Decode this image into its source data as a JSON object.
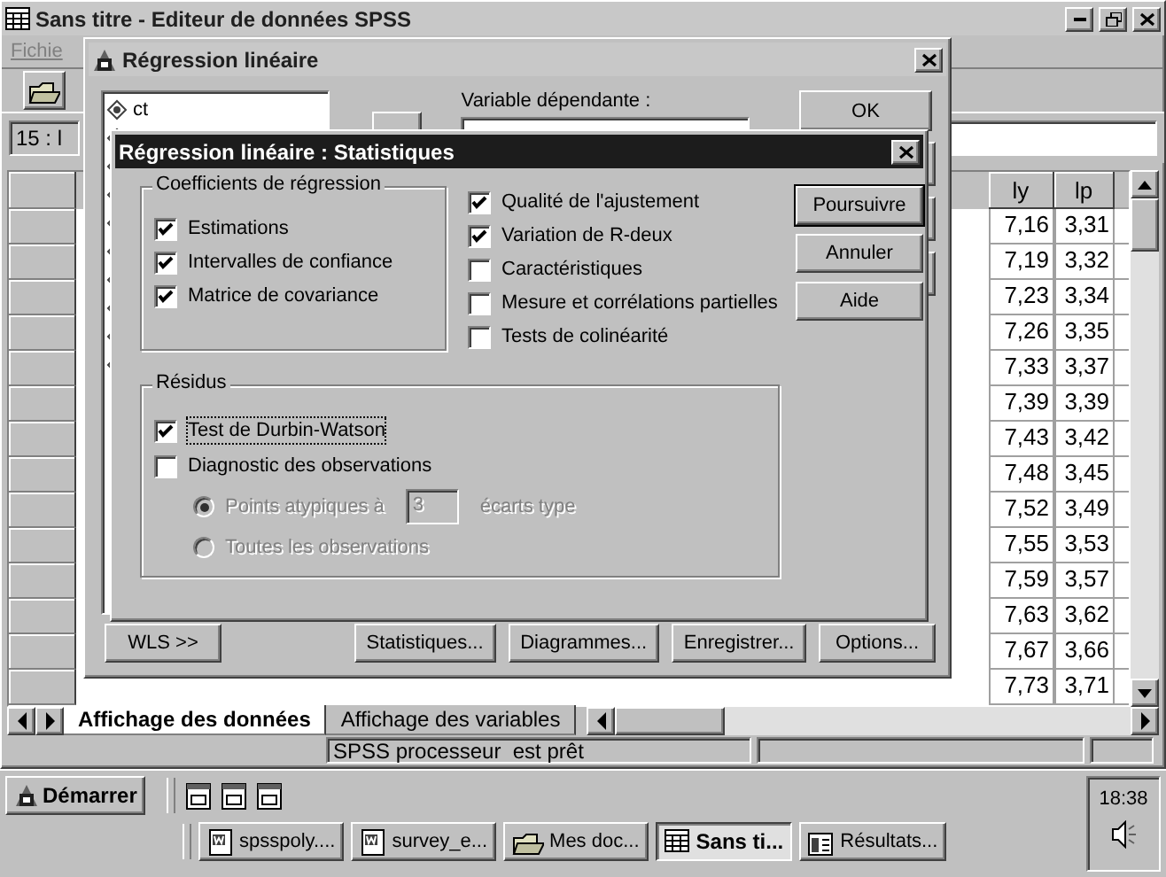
{
  "main_window": {
    "title": "Sans titre - Editeur de données SPSS",
    "menu": [
      "Fichie"
    ],
    "cell_ref": "15 : l",
    "grid": {
      "columns": [
        "ly",
        "lp"
      ],
      "rows": [
        [
          "7,16",
          "3,31"
        ],
        [
          "7,19",
          "3,32"
        ],
        [
          "7,23",
          "3,34"
        ],
        [
          "7,26",
          "3,35"
        ],
        [
          "7,33",
          "3,37"
        ],
        [
          "7,39",
          "3,39"
        ],
        [
          "7,43",
          "3,42"
        ],
        [
          "7,48",
          "3,45"
        ],
        [
          "7,52",
          "3,49"
        ],
        [
          "7,55",
          "3,53"
        ],
        [
          "7,59",
          "3,57"
        ],
        [
          "7,63",
          "3,62"
        ],
        [
          "7,67",
          "3,66"
        ],
        [
          "7,73",
          "3,71"
        ]
      ]
    },
    "tabs": [
      {
        "label": "Affichage des données",
        "selected": true
      },
      {
        "label": "Affichage des variables",
        "selected": false
      }
    ],
    "status_bar": "SPSS processeur  est prêt"
  },
  "regression_dialog": {
    "title": "Régression linéaire",
    "variables": [
      "ct"
    ],
    "dependent_label": "Variable dépendante :",
    "buttons": [
      "OK"
    ],
    "bottom_buttons": [
      "WLS >>",
      "Statistiques...",
      "Diagrammes...",
      "Enregistrer...",
      "Options..."
    ]
  },
  "statistics_dialog": {
    "title": "Régression linéaire : Statistiques",
    "coefficients": {
      "title": "Coefficients de régression",
      "options": [
        {
          "label": "Estimations",
          "checked": true
        },
        {
          "label": "Intervalles de confiance",
          "checked": true
        },
        {
          "label": "Matrice de covariance",
          "checked": true
        }
      ]
    },
    "options": [
      {
        "label": "Qualité de l'ajustement",
        "checked": true
      },
      {
        "label": "Variation de R-deux",
        "checked": true
      },
      {
        "label": "Caractéristiques",
        "checked": false
      },
      {
        "label": "Mesure et corrélations partielles",
        "checked": false
      },
      {
        "label": "Tests de colinéarité",
        "checked": false
      }
    ],
    "buttons": [
      "Poursuivre",
      "Annuler",
      "Aide"
    ],
    "residuals": {
      "title": "Résidus",
      "options": [
        {
          "label": "Test de Durbin-Watson",
          "checked": true,
          "focused": true
        },
        {
          "label": "Diagnostic des observations",
          "checked": false,
          "focused": false
        }
      ],
      "choices": [
        {
          "label": "Points atypiques à",
          "selected": true,
          "disabled": true,
          "value": "3",
          "suffix": "écarts type"
        },
        {
          "label": "Toutes les observations",
          "selected": false,
          "disabled": true
        }
      ]
    }
  },
  "taskbar": {
    "start": "Démarrer",
    "tasks": [
      {
        "label": "spsspoly....",
        "kind": "document",
        "selected": false
      },
      {
        "label": "survey_e...",
        "kind": "document",
        "selected": false
      },
      {
        "label": "Mes doc...",
        "kind": "folder",
        "selected": false
      },
      {
        "label": "Sans ti...",
        "kind": "data",
        "selected": true
      },
      {
        "label": "Résultats...",
        "kind": "output",
        "selected": false
      }
    ],
    "clock": "18:38"
  }
}
